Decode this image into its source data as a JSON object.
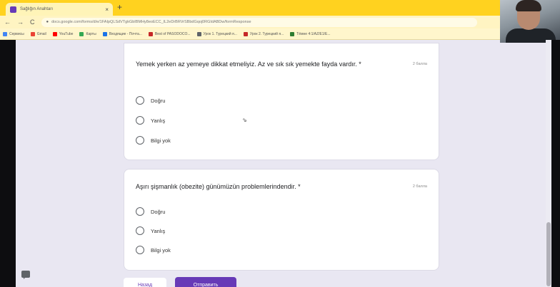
{
  "browser": {
    "tab_title": "Sağlığın Anahtarı",
    "tab_close": "×",
    "new_tab": "+",
    "url": "docs.google.com/forms/d/e/1FAIpQLSdVTgkGbIBMHy8eoECC_IL2eDrBRVrSBbdGqoj0RGIdABDw/formResponse",
    "nav": {
      "back": "←",
      "forward": "→",
      "reload": "C"
    },
    "bookmarks": [
      {
        "label": "Сервисы",
        "color": "#4285f4"
      },
      {
        "label": "Gmail",
        "color": "#ea4335"
      },
      {
        "label": "YouTube",
        "color": "#ff0000"
      },
      {
        "label": "Карты",
        "color": "#34a853"
      },
      {
        "label": "Входящие - Почта...",
        "color": "#1a73e8"
      },
      {
        "label": "Best of PASODOCO...",
        "color": "#c62828"
      },
      {
        "label": "Урок 1. Турецкий я...",
        "color": "#5f6368"
      },
      {
        "label": "Урок 2. Турецкий я...",
        "color": "#c62828"
      },
      {
        "label": "Тёмнe 4:1/AZ/E1/E...",
        "color": "#2e7d32"
      }
    ]
  },
  "questions": [
    {
      "title": "Yemek yerken az yemeye dikkat etmeliyiz. Az ve sık sık yemekte fayda vardır. *",
      "points": "2 балла",
      "options": [
        "Doğru",
        "Yanlış",
        "Bilgi yok"
      ]
    },
    {
      "title": "Aşırı şişmanlık (obezite) günümüzün problemlerindendir. *",
      "points": "2 балла",
      "options": [
        "Doğru",
        "Yanlış",
        "Bilgi yok"
      ]
    }
  ],
  "buttons": {
    "back": "Назад",
    "submit": "Отправить"
  },
  "cursor": "⇘"
}
